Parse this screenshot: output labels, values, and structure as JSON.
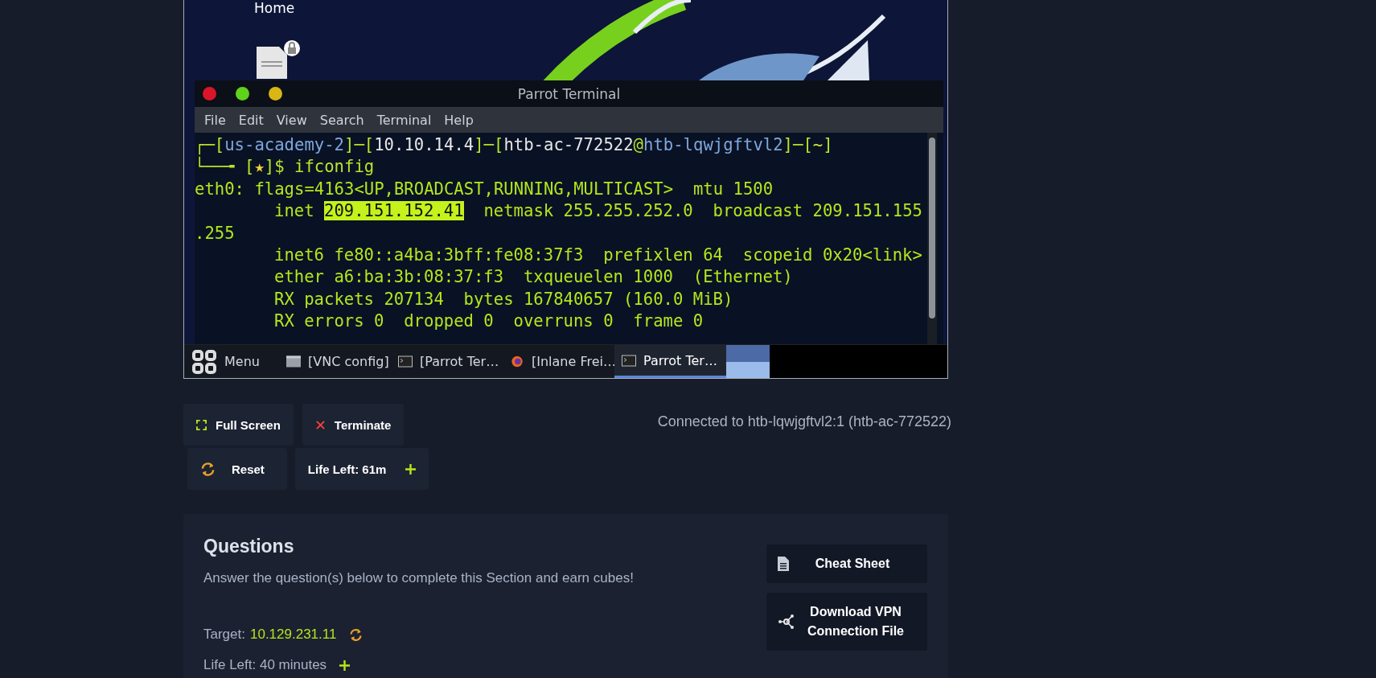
{
  "desktop": {
    "icons": [
      {
        "label": "Home"
      }
    ]
  },
  "terminal": {
    "title": "Parrot Terminal",
    "menu": [
      "File",
      "Edit",
      "View",
      "Search",
      "Terminal",
      "Help"
    ],
    "lines": [
      {
        "indented": false,
        "segments": [
          {
            "kind": "frame",
            "text": "┌─["
          },
          {
            "kind": "host",
            "text": "us-academy-2"
          },
          {
            "kind": "frame",
            "text": "]─["
          },
          {
            "kind": "plain",
            "text": "10.10.14.4"
          },
          {
            "kind": "frame",
            "text": "]─["
          },
          {
            "kind": "plain",
            "text": "htb-ac-772522"
          },
          {
            "kind": "frame",
            "text": "@"
          },
          {
            "kind": "host",
            "text": "htb-lqwjgftvl2"
          },
          {
            "kind": "frame",
            "text": "]─["
          },
          {
            "kind": "path",
            "text": "~"
          },
          {
            "kind": "frame",
            "text": "]"
          }
        ]
      },
      {
        "indented": false,
        "segments": [
          {
            "kind": "frame",
            "text": "└──╼ ["
          },
          {
            "kind": "star",
            "text": "★"
          },
          {
            "kind": "frame",
            "text": "]$ ifconfig"
          }
        ]
      },
      {
        "indented": false,
        "segments": [
          {
            "kind": "output",
            "text": "eth0: flags=4163<UP,BROADCAST,RUNNING,MULTICAST>  mtu 1500"
          }
        ]
      },
      {
        "indented": true,
        "segments": [
          {
            "kind": "output",
            "text": "inet "
          },
          {
            "kind": "highlight",
            "text": "209.151.152.41"
          },
          {
            "kind": "output",
            "text": "  netmask 255.255.252.0  broadcast 209.151.155"
          }
        ]
      },
      {
        "indented": false,
        "segments": [
          {
            "kind": "output",
            "text": ".255"
          }
        ]
      },
      {
        "indented": true,
        "segments": [
          {
            "kind": "output",
            "text": "inet6 fe80::a4ba:3bff:fe08:37f3  prefixlen 64  scopeid 0x20<link>"
          }
        ]
      },
      {
        "indented": true,
        "segments": [
          {
            "kind": "output",
            "text": "ether a6:ba:3b:08:37:f3  txqueuelen 1000  (Ethernet)"
          }
        ]
      },
      {
        "indented": true,
        "segments": [
          {
            "kind": "output",
            "text": "RX packets 207134  bytes 167840657 (160.0 MiB)"
          }
        ]
      },
      {
        "indented": true,
        "segments": [
          {
            "kind": "output",
            "text": "RX errors 0  dropped 0  overruns 0  frame 0"
          }
        ]
      }
    ]
  },
  "taskbar": {
    "menu_label": "Menu",
    "items": [
      {
        "kind": "window",
        "label": "[VNC config]",
        "selected": false
      },
      {
        "kind": "terminal",
        "label": "[Parrot Ter…",
        "selected": false
      },
      {
        "kind": "browser",
        "label": "[Inlane Frei…",
        "selected": false
      },
      {
        "kind": "terminal",
        "label": "Parrot Ter…",
        "selected": true
      }
    ]
  },
  "controls": {
    "buttons": [
      {
        "kind": "fullscreen",
        "label": "Full Screen"
      },
      {
        "kind": "terminate",
        "label": "Terminate"
      },
      {
        "kind": "reset",
        "label": "Reset"
      }
    ],
    "life_left": "Life Left: 61m",
    "connection": "Connected to htb-lqwjgftvl2:1 (htb-ac-772522)"
  },
  "questions": {
    "title": "Questions",
    "description": "Answer the question(s) below to complete this Section and earn cubes!",
    "target_label": "Target:",
    "target": "10.129.231.11",
    "life_left": "Life Left: 40 minutes",
    "side_buttons": [
      {
        "kind": "cheatsheet",
        "label": "Cheat Sheet"
      },
      {
        "kind": "vpn",
        "label": "Download VPN Connection File"
      }
    ]
  }
}
